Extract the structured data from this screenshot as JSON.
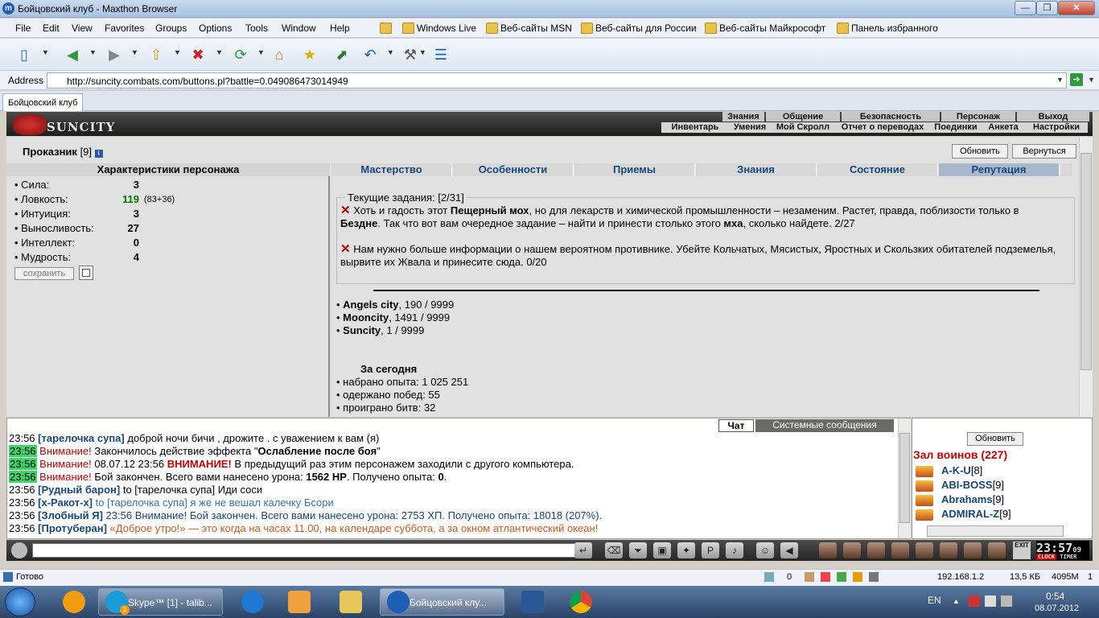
{
  "window": {
    "title": "Бойцовский клуб - Maxthon Browser",
    "min": "—",
    "max": "❐",
    "close": "✕"
  },
  "menu": [
    "File",
    "Edit",
    "View",
    "Favorites",
    "Groups",
    "Options",
    "Tools",
    "Window",
    "Help"
  ],
  "favorites": [
    "Windows Live",
    "Веб-сайты MSN",
    "Веб-сайты для России",
    "Веб-сайты Майкрософт",
    "Панель избранного"
  ],
  "address": {
    "label": "Address",
    "url": "http://suncity.combats.com/buttons.pl?battle=0.049086473014949"
  },
  "tab": {
    "label": "Бойцовский клуб"
  },
  "game": {
    "brand": "SUNCITY",
    "nav_top": [
      "Знания",
      "Общение",
      "Безопасность",
      "Персонаж",
      "Выход"
    ],
    "nav_sub": [
      "Инвентарь",
      "Умения",
      "Мой Скролл",
      "Отчет о переводах",
      "Поединки",
      "Анкета",
      "Настройки"
    ],
    "player": {
      "name": "Проказник",
      "level": "[9]"
    },
    "buttons": {
      "refresh": "Обновить",
      "return": "Вернуться",
      "save": "сохранить"
    },
    "stats_title": "Характеристики персонажа",
    "stats": [
      {
        "label": "• Сила:",
        "value": "3",
        "extra": ""
      },
      {
        "label": "• Ловкость:",
        "value": "119",
        "extra": "(83+36)"
      },
      {
        "label": "• Интуиция:",
        "value": "3",
        "extra": ""
      },
      {
        "label": "• Выносливость:",
        "value": "27",
        "extra": ""
      },
      {
        "label": "• Интеллект:",
        "value": "0",
        "extra": ""
      },
      {
        "label": "• Мудрость:",
        "value": "4",
        "extra": ""
      }
    ],
    "tabs": [
      "Мастерство",
      "Особенности",
      "Приемы",
      "Знания",
      "Состояние",
      "Репутация"
    ],
    "quests": {
      "legend": "Текущие задания: [2/31]",
      "q1": {
        "a": "Хоть и гадость этот ",
        "b": "Пещерный мох",
        "c": ", но для лекарств и химической промышленности – незаменим. Растет, правда, поблизости только в ",
        "d": "Бездне",
        "e": ". Так что вот вам очередное задание – найти и принести столько этого ",
        "f": "мха",
        "g": ", сколько найдете. 2/27"
      },
      "q2": "Нам нужно больше информации о нашем вероятном противнике. Убейте Кольчатых, Мясистых, Яростных и Скользких обитателей подземелья, вырвите их Жвала и принесите сюда. 0/20"
    },
    "cities": [
      {
        "name": "Angels city",
        "value": ", 190 / 9999"
      },
      {
        "name": "Mooncity",
        "value": ", 1491 / 9999"
      },
      {
        "name": "Suncity",
        "value": ", 1 / 9999"
      }
    ],
    "today": {
      "title": "За сегодня",
      "lines": [
        "• набрано опыта: 1 025 251",
        "• одержано побед: 55",
        "• проиграно битв: 32"
      ]
    }
  },
  "chat": {
    "tabs": [
      "Чат",
      "Системные сообщения"
    ],
    "lines": [
      {
        "time": "23:56",
        "hl": false,
        "nick": "[тарелочка супа]",
        "text": " доброй ночи бичи , дрожите . с уважением к вам (я)"
      },
      {
        "time": "23:56",
        "hl": true,
        "warn": "Внимание!",
        "text": " Закончилось действие эффекта \"",
        "bold": "Ослабление после боя",
        "end": "\""
      },
      {
        "time": "23:56",
        "hl": true,
        "warn": "Внимание!",
        "text": " 08.07.12 23:56 ",
        "bold2": "ВНИМАНИЕ!",
        "end": " В предыдущий раз этим персонажем заходили с другого компьютера."
      },
      {
        "time": "23:56",
        "hl": true,
        "warn": "Внимание!",
        "text": " Бой закончен. Всего вами нанесено урона: ",
        "bold": "1562 HP",
        "mid": ". Получено опыта: ",
        "bold3": "0",
        "end": "."
      },
      {
        "time": "23:56",
        "hl": false,
        "nick": "[Рудный барон]",
        "text": " to [тарелочка супа] Иди соси"
      },
      {
        "time": "23:56",
        "hl": false,
        "nick": "[x-Ракот-x]",
        "text": " to [тарелочка супа] я же не вешал калечку Бсори"
      },
      {
        "time": "23:56",
        "hl": false,
        "nick": "[Злобный Я]",
        "text": " 23:56 Внимание! Бой закончен. Всего вами нанесено урона: 2753 ХП. Получено опыта: 18018 (207%)."
      },
      {
        "time": "23:56",
        "hl": false,
        "nick": "[Протуберан]",
        "text": " «Доброе утро!» — это когда на часах 11.00, на календаре суббота, а за окном атлантический океан!"
      }
    ]
  },
  "online": {
    "refresh": "Обновить",
    "title": "Зал воинов (227)",
    "users": [
      {
        "name": "A-K-U",
        "lvl": "[8]"
      },
      {
        "name": "ABI-BOSS",
        "lvl": "[9]"
      },
      {
        "name": "Abrahams",
        "lvl": "[9]"
      },
      {
        "name": "ADMIRAL-Z",
        "lvl": "[9]"
      }
    ]
  },
  "clock": {
    "time": "23:57",
    "sec": "09",
    "clock_lbl": "CLOCK",
    "timer_lbl": "TIMER",
    "exit": "EXIT"
  },
  "status": {
    "ready": "Готово",
    "count": "0",
    "ip": "192.168.1.2",
    "size": "13,5 КБ",
    "mem": "4095M",
    "num": "1"
  },
  "taskbar": {
    "skype": "Skype™ [1] - talib...",
    "skype_badge": "1",
    "browser": "Бойцовский клу...",
    "lang": "EN",
    "time": "0:54",
    "date": "08.07.2012"
  }
}
